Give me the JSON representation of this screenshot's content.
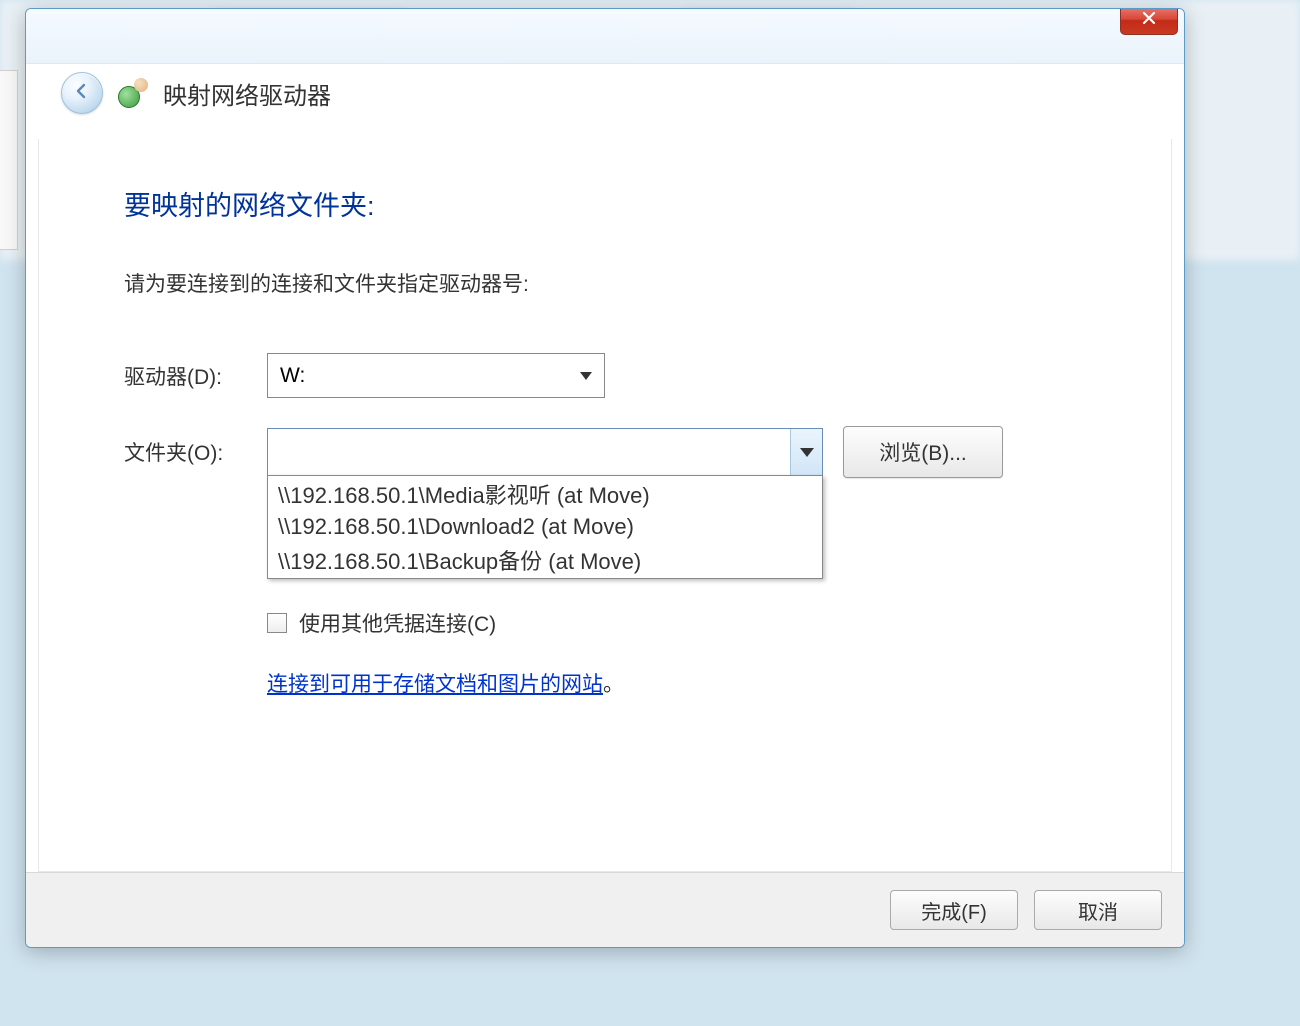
{
  "dialog": {
    "title": "映射网络驱动器",
    "heading": "要映射的网络文件夹:",
    "instruction": "请为要连接到的连接和文件夹指定驱动器号:",
    "drive_label": "驱动器(D):",
    "drive_value": "W:",
    "folder_label": "文件夹(O):",
    "folder_value": "",
    "browse_label": "浏览(B)...",
    "dropdown_items": [
      "\\\\192.168.50.1\\Media影视听 (at Move)",
      "\\\\192.168.50.1\\Download2 (at Move)",
      "\\\\192.168.50.1\\Backup备份 (at Move)"
    ],
    "checkbox_label": "使用其他凭据连接(C)",
    "link_text": "连接到可用于存储文档和图片的网站",
    "link_period": "。",
    "finish_label": "完成(F)",
    "cancel_label": "取消"
  }
}
